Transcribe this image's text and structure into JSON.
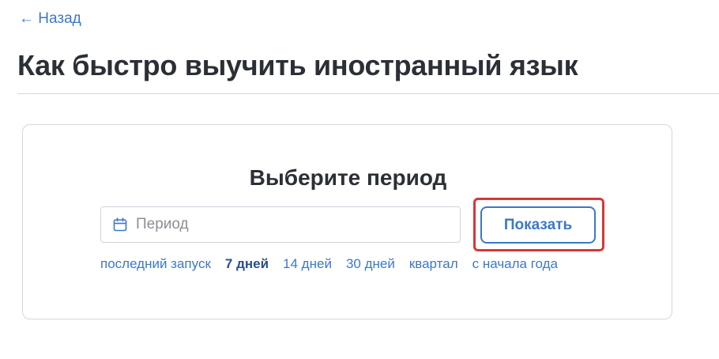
{
  "nav": {
    "back_label": "← Назад"
  },
  "page": {
    "title": "Как быстро выучить иностранный язык"
  },
  "period_panel": {
    "title": "Выберите период",
    "input_placeholder": "Период",
    "input_value": "",
    "show_button_label": "Показать",
    "quick_ranges": [
      {
        "label": "последний запуск",
        "active": false
      },
      {
        "label": "7 дней",
        "active": true
      },
      {
        "label": "14 дней",
        "active": false
      },
      {
        "label": "30 дней",
        "active": false
      },
      {
        "label": "квартал",
        "active": false
      },
      {
        "label": "с начала года",
        "active": false
      }
    ]
  },
  "colors": {
    "accent": "#3b78c9",
    "active_range": "#28508c",
    "highlight": "#d93636",
    "title_text": "#2b2f36"
  },
  "icons": {
    "period_input": "calendar-icon"
  }
}
